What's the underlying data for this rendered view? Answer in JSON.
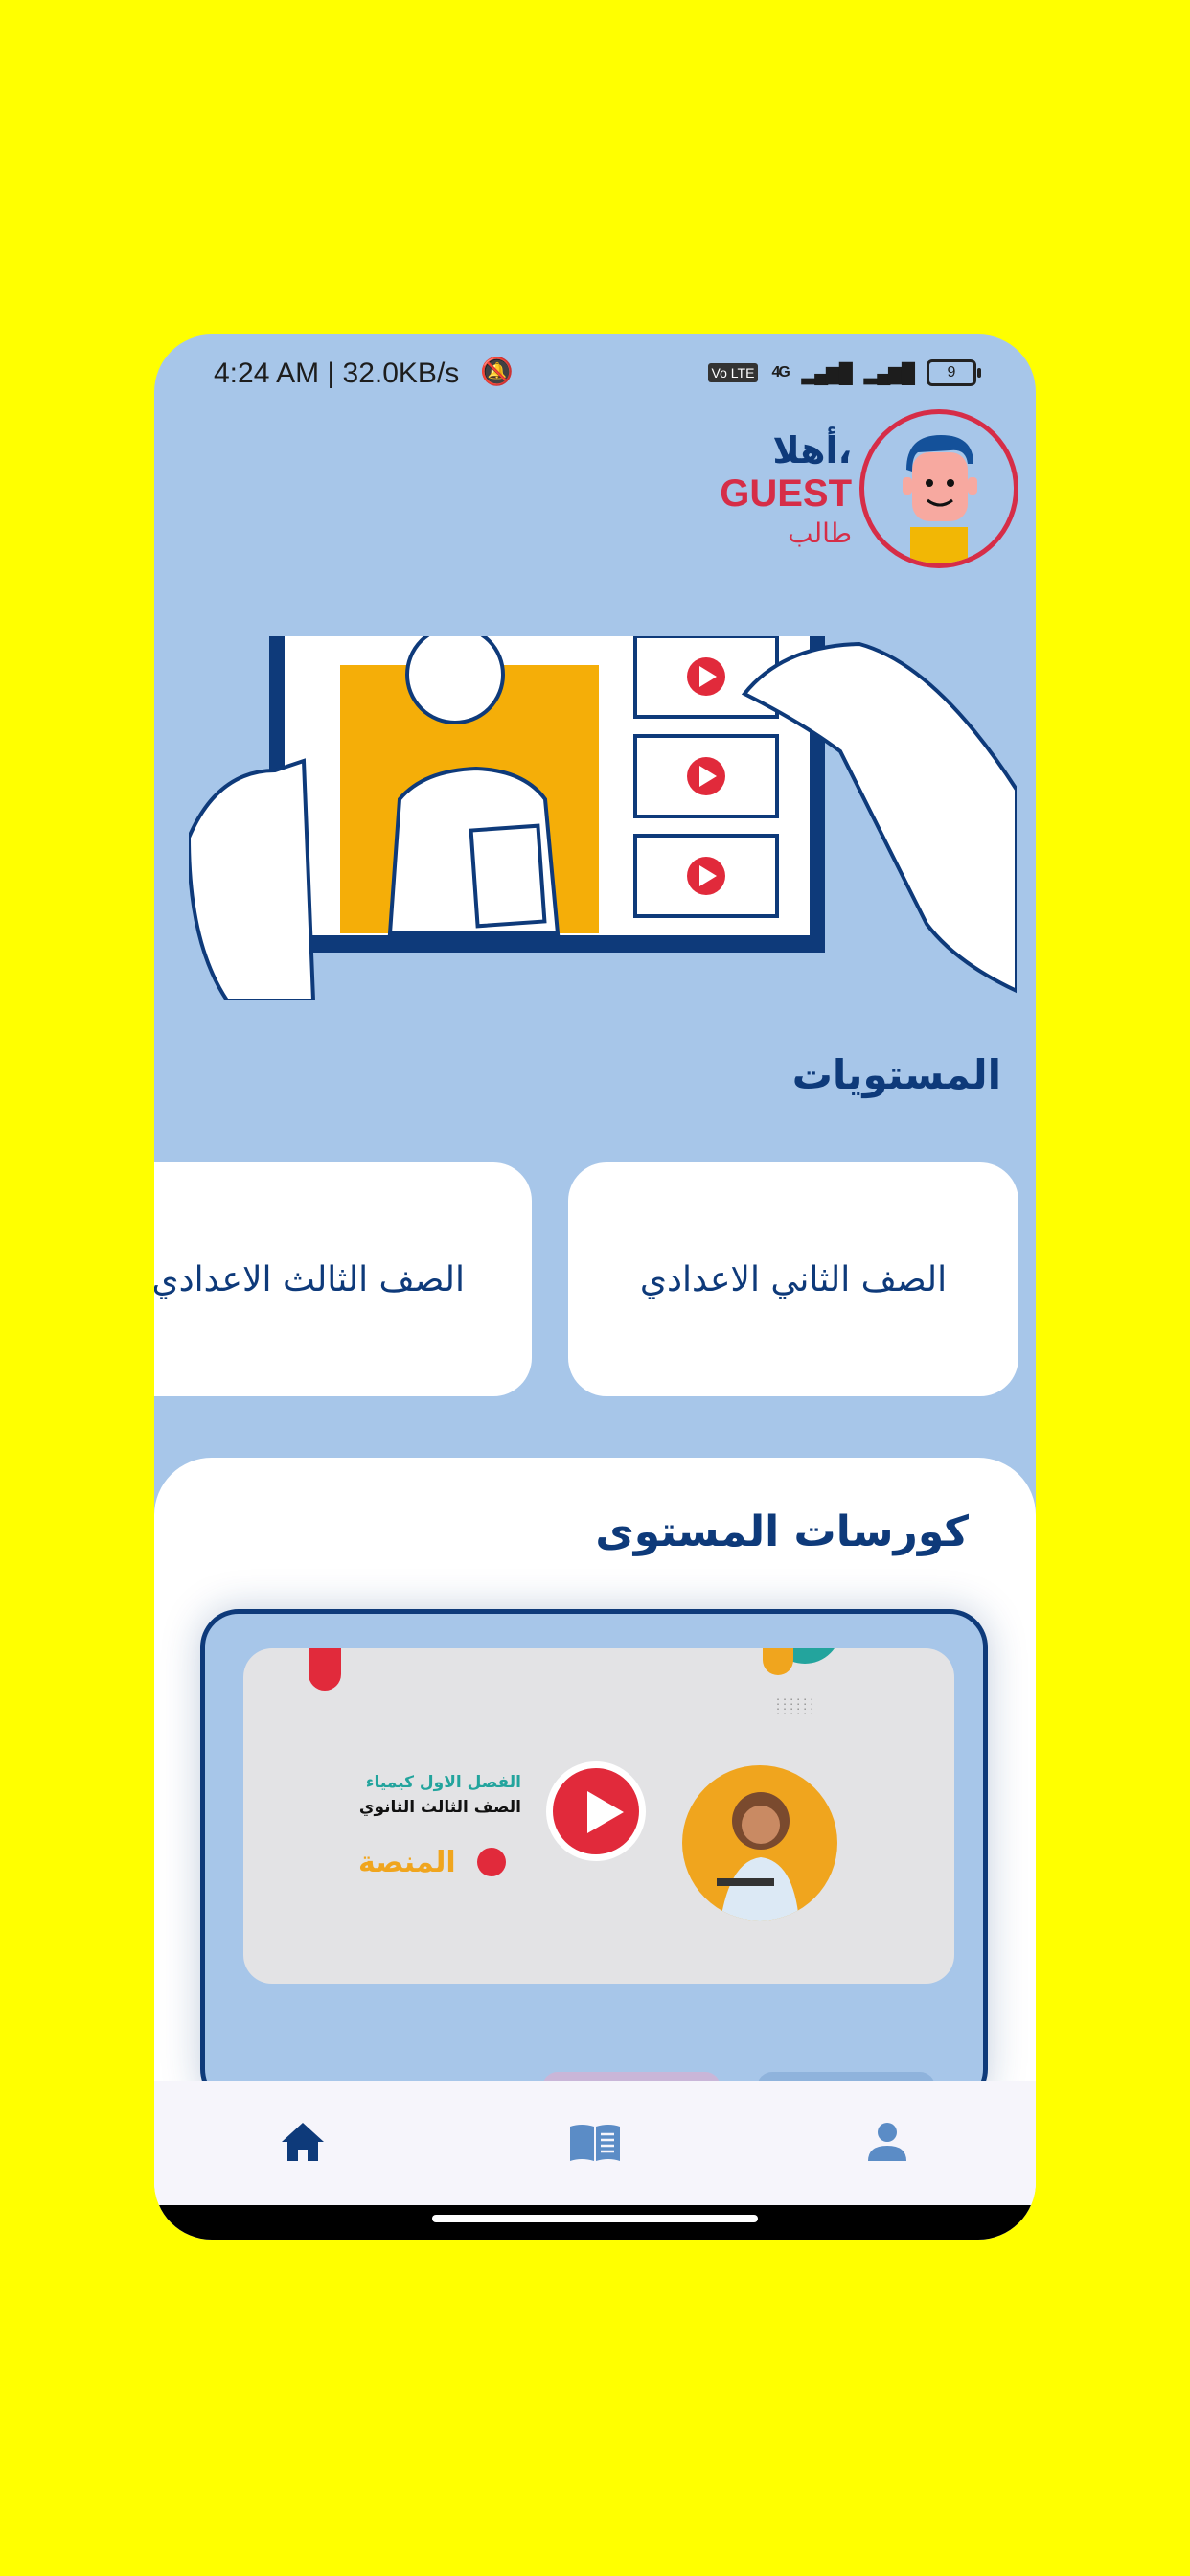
{
  "status_bar": {
    "time": "4:24 AM | 32.0KB/s",
    "network": "4G",
    "battery": "9"
  },
  "profile": {
    "greeting": "أهلا،",
    "name": "GUEST",
    "role": "طالب"
  },
  "levels": {
    "title": "المستويات",
    "items": [
      "الصف الثاني الاعدادي",
      "الصف الثالث الاعدادي"
    ]
  },
  "courses": {
    "title": "كورسات المستوى",
    "card": {
      "line1": "الفصل الاول كيمياء",
      "line2": "الصف الثالث الثانوي",
      "brand": "المنصة"
    }
  },
  "nav": {
    "items": [
      "home-icon",
      "book-icon",
      "person-icon"
    ],
    "active_color": "#0E3A7A",
    "inactive_color": "#5B8CC6"
  },
  "colors": {
    "background": "#FFFF00",
    "app_bg": "#A7C6E9",
    "primary": "#0E3A7A",
    "accent": "#D62D47"
  }
}
